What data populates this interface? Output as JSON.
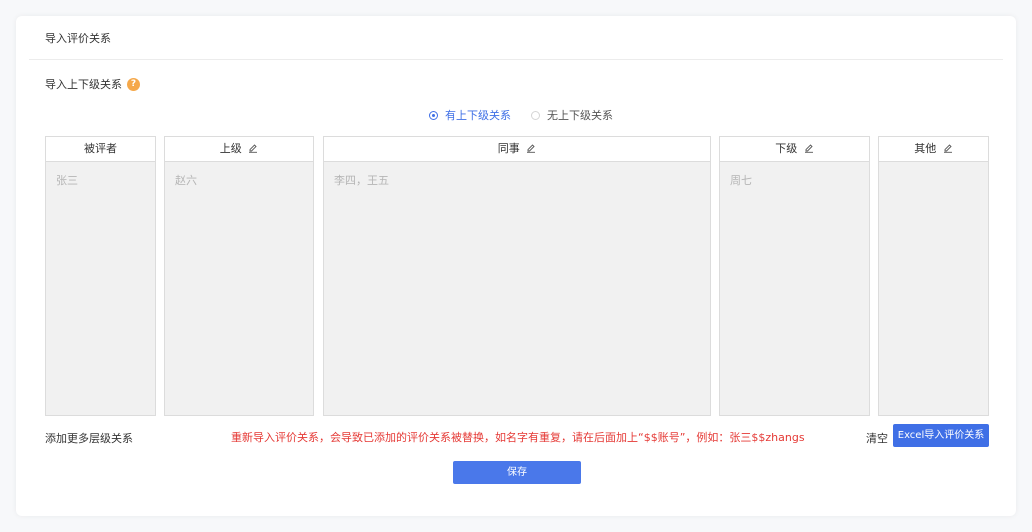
{
  "header": {
    "title": "导入评价关系"
  },
  "section": {
    "label": "导入上下级关系",
    "help_icon": "question-icon",
    "help_glyph": "?"
  },
  "radios": [
    {
      "label": "有上下级关系",
      "checked": true
    },
    {
      "label": "无上下级关系",
      "checked": false
    }
  ],
  "columns": {
    "evaluatee": {
      "header": "被评者",
      "placeholder": "张三"
    },
    "superior": {
      "header": "上级",
      "placeholder": "赵六",
      "icon": "edit-icon"
    },
    "peer": {
      "header": "同事",
      "placeholder": "李四，王五",
      "icon": "edit-icon"
    },
    "subordinate": {
      "header": "下级",
      "placeholder": "周七",
      "icon": "edit-icon"
    },
    "other": {
      "header": "其他",
      "placeholder": "",
      "icon": "edit-icon"
    }
  },
  "footer": {
    "add_more": "添加更多层级关系",
    "warning": "重新导入评价关系，会导致已添加的评价关系被替换，如名字有重复，请在后面加上“$$账号”，例如：张三$$zhangs",
    "clear": "清空",
    "excel_button": "Excel导入评价关系",
    "save_button": "保存"
  },
  "colors": {
    "primary": "#3f6fe6",
    "warning": "#e53935",
    "help": "#f5a84a"
  }
}
